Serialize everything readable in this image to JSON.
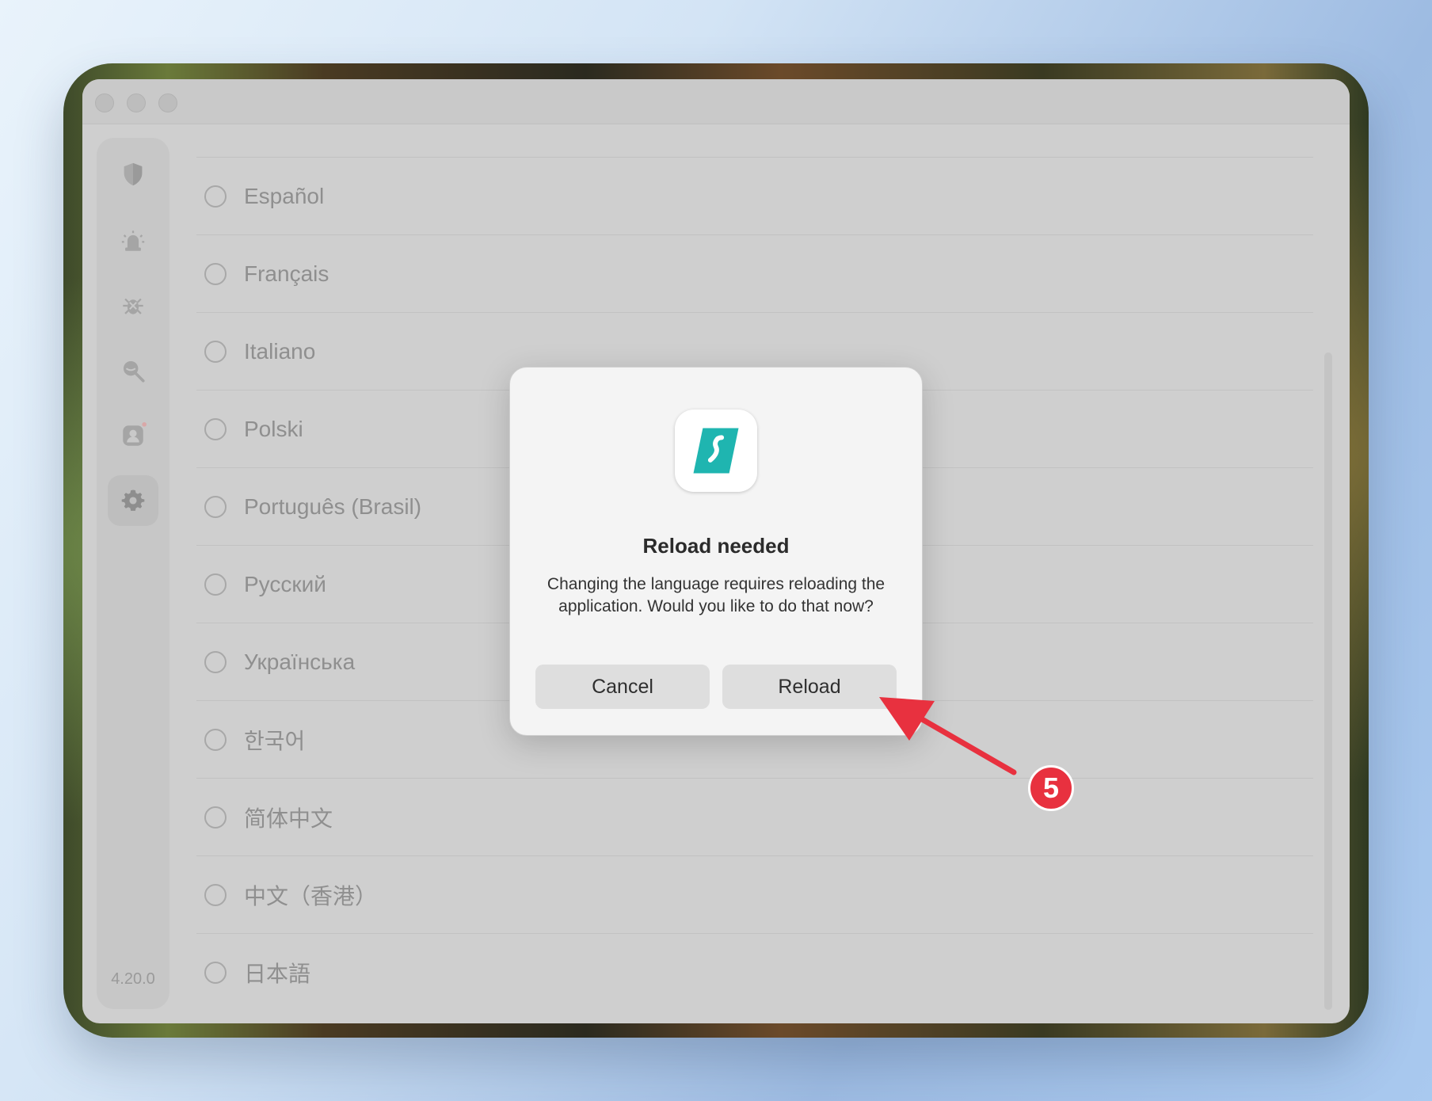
{
  "app": {
    "version": "4.20.0"
  },
  "sidebar": {
    "items": [
      {
        "name": "vpn",
        "icon": "shield-icon"
      },
      {
        "name": "alert",
        "icon": "alarm-icon"
      },
      {
        "name": "antivirus",
        "icon": "bug-icon"
      },
      {
        "name": "search",
        "icon": "search-eye-icon"
      },
      {
        "name": "account",
        "icon": "user-icon"
      },
      {
        "name": "settings",
        "icon": "gear-icon",
        "active": true
      }
    ]
  },
  "languages": [
    {
      "label": "Español"
    },
    {
      "label": "Français"
    },
    {
      "label": "Italiano"
    },
    {
      "label": "Polski"
    },
    {
      "label": "Português (Brasil)"
    },
    {
      "label": "Русский"
    },
    {
      "label": "Українська"
    },
    {
      "label": "한국어"
    },
    {
      "label": "简体中文"
    },
    {
      "label": "中文（香港）"
    },
    {
      "label": "日本語"
    }
  ],
  "dialog": {
    "title": "Reload needed",
    "message": "Changing the language requires reloading the application. Would you like to do that now?",
    "cancel_label": "Cancel",
    "reload_label": "Reload"
  },
  "annotation": {
    "step": "5",
    "color": "#e8313f"
  },
  "colors": {
    "accent": "#1fb5b0"
  }
}
